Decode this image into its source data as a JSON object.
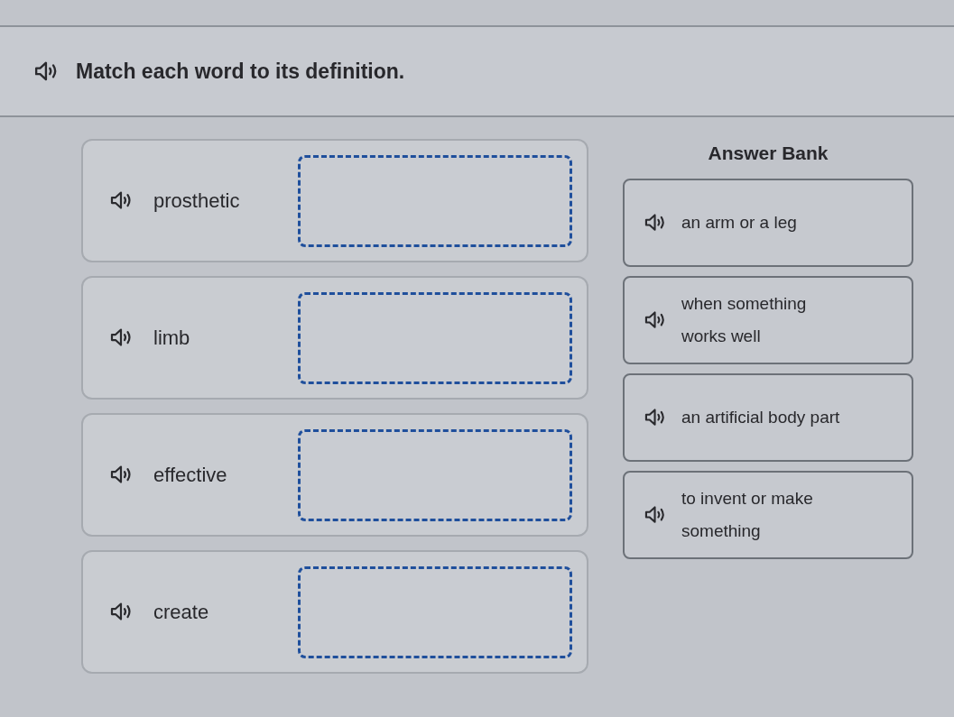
{
  "prompt": {
    "text": "Match each word to its definition."
  },
  "terms": [
    {
      "word": "prosthetic"
    },
    {
      "word": "limb"
    },
    {
      "word": "effective"
    },
    {
      "word": "create"
    }
  ],
  "answer_bank": {
    "title": "Answer Bank",
    "answers": [
      {
        "text": "an arm or a leg"
      },
      {
        "text": "when something\nworks well"
      },
      {
        "text": "an artificial body part"
      },
      {
        "text": "to invent or make\nsomething"
      }
    ]
  }
}
